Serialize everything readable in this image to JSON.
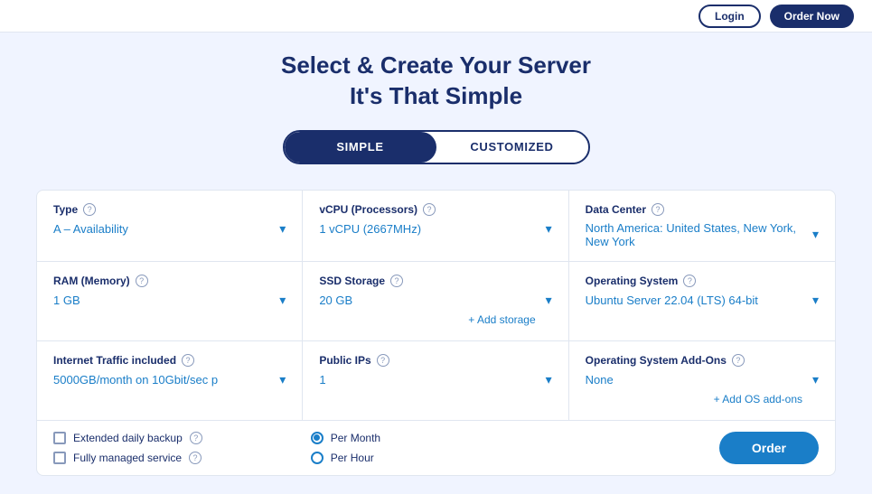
{
  "topbar": {
    "btn_login": "Login",
    "btn_order": "Order Now"
  },
  "header": {
    "line1": "Select & Create Your Server",
    "line2": "It's That Simple"
  },
  "toggle": {
    "simple_label": "SIMPLE",
    "customized_label": "CUSTOMIZED",
    "active": "simple"
  },
  "fields": {
    "type": {
      "label": "Type",
      "value": "A – Availability"
    },
    "vcpu": {
      "label": "vCPU (Processors)",
      "value": "1 vCPU (2667MHz)"
    },
    "datacenter": {
      "label": "Data Center",
      "value": "North America: United States, New York, New York"
    },
    "ram": {
      "label": "RAM (Memory)",
      "value": "1 GB"
    },
    "ssd": {
      "label": "SSD Storage",
      "value": "20 GB"
    },
    "os": {
      "label": "Operating System",
      "value": "Ubuntu Server 22.04 (LTS) 64-bit"
    },
    "traffic": {
      "label": "Internet Traffic included",
      "value": "5000GB/month on 10Gbit/sec p"
    },
    "public_ips": {
      "label": "Public IPs",
      "value": "1"
    },
    "os_addons": {
      "label": "Operating System Add-Ons",
      "value": "None"
    }
  },
  "links": {
    "add_storage": "+ Add storage",
    "add_os_addons": "+ Add OS add-ons"
  },
  "billing": {
    "extended_backup": "Extended daily backup",
    "managed_service": "Fully managed service",
    "per_month": "Per Month",
    "per_hour": "Per Hour"
  },
  "icons": {
    "help": "?",
    "chevron": "▾"
  }
}
